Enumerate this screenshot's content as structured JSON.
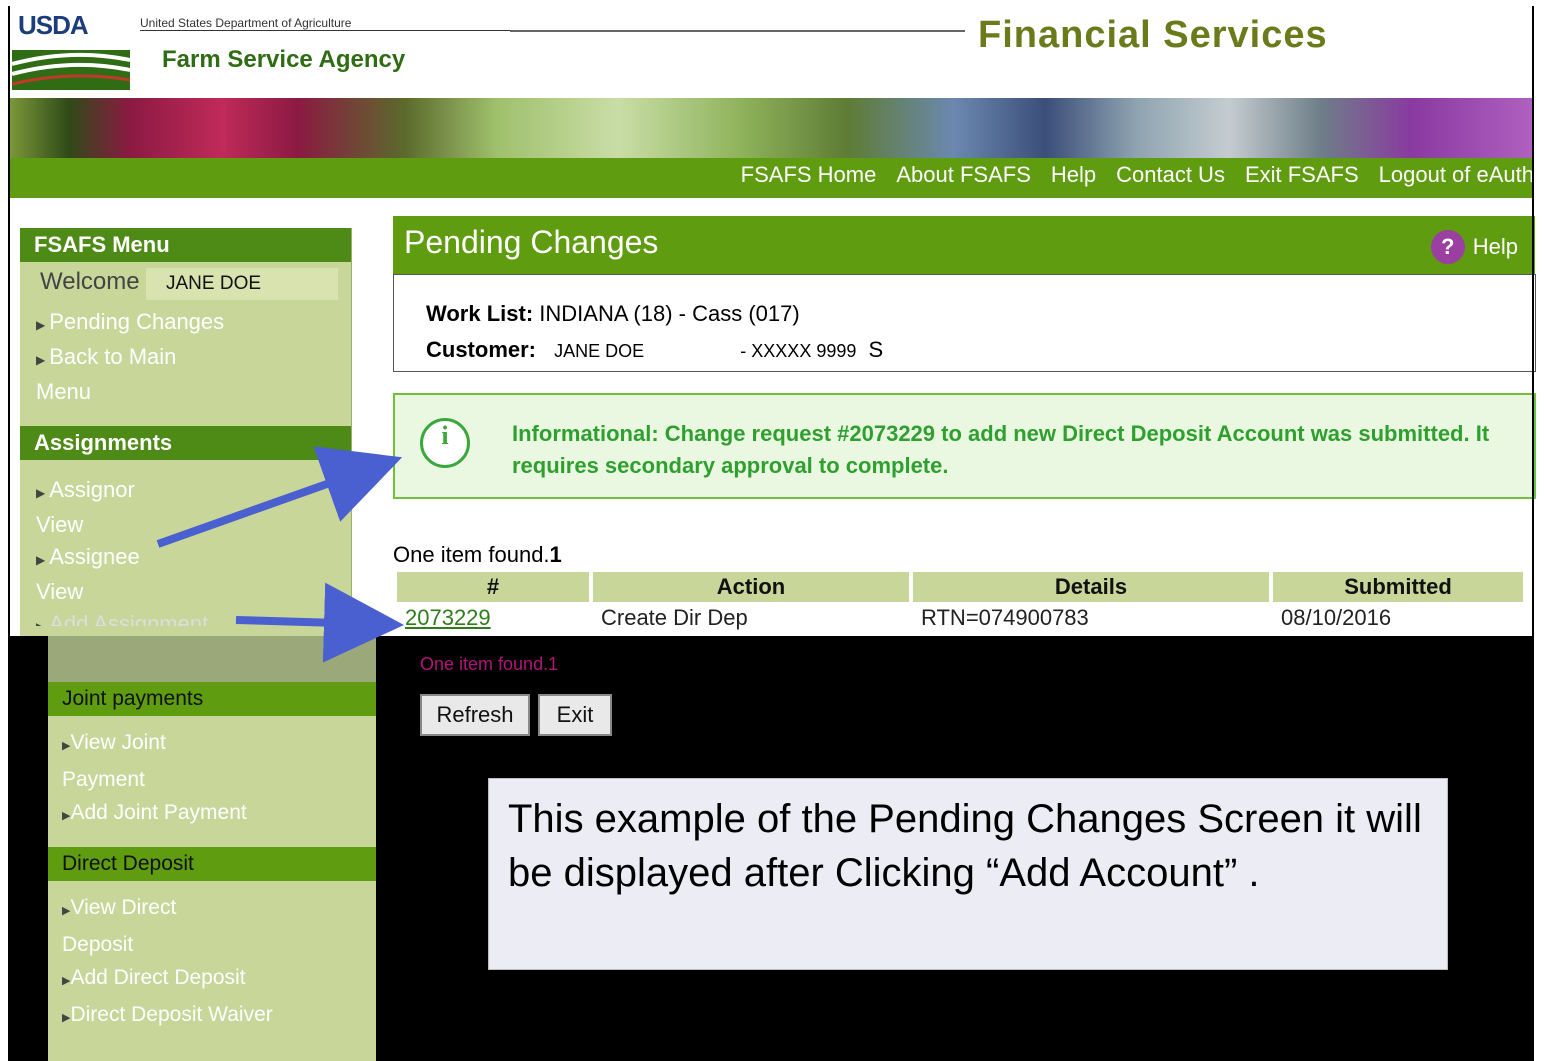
{
  "header": {
    "logo_text": "USDA",
    "department": "United States Department of Agriculture",
    "agency": "Farm Service Agency",
    "app_title": "Financial Services"
  },
  "nav": {
    "links": [
      "FSAFS Home",
      "About FSAFS",
      "Help",
      "Contact Us",
      "Exit FSAFS",
      "Logout of eAuth"
    ]
  },
  "sidebar": {
    "menu_title": "FSAFS Menu",
    "welcome_label": "Welcome",
    "welcome_user": "JANE DOE",
    "menu_items": [
      "Pending Changes",
      "Back to Main Menu"
    ],
    "assignments_title": "Assignments",
    "assignment_items": [
      "Assignor View",
      "Assignee View",
      "Add Assignment"
    ],
    "joint_title": "Joint payments",
    "joint_items": [
      "View Joint Payment",
      "Add Joint Payment"
    ],
    "dd_title": "Direct Deposit",
    "dd_items": [
      "View Direct Deposit",
      "Add Direct Deposit",
      "Direct Deposit Waiver"
    ]
  },
  "main": {
    "title": "Pending Changes",
    "help_label": "Help",
    "worklist_label": "Work List:",
    "worklist_value": "INDIANA (18) - Cass (017)",
    "customer_label": "Customer:",
    "customer_name": "JANE DOE",
    "customer_id": "- XXXXX 9999",
    "customer_type": "S",
    "info_message": "Informational: Change request #2073229 to add new Direct Deposit Account was submitted. It requires secondary approval to complete.",
    "count_text": "One item found.",
    "count_num": "1",
    "table": {
      "headers": [
        "#",
        "Action",
        "Details",
        "Submitted"
      ],
      "rows": [
        {
          "id": "2073229",
          "action": "Create Dir Dep",
          "details": "RTN=074900783",
          "submitted": "08/10/2016"
        }
      ]
    },
    "count_bottom": "One item found.1",
    "refresh_label": "Refresh",
    "exit_label": "Exit"
  },
  "note": {
    "text": "This example of the Pending Changes Screen it will be displayed after Clicking “Add Account” ."
  },
  "colors": {
    "nav_green": "#5f9c10",
    "menu_bg": "#c8d69a",
    "info_green": "#2fa02f",
    "arrow_blue": "#4a5fd0"
  }
}
